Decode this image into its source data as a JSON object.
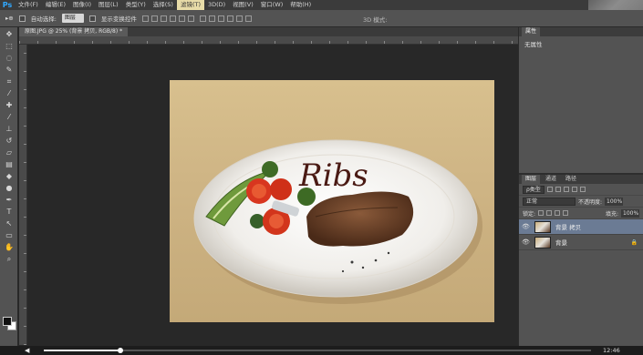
{
  "app": {
    "logo": "Ps"
  },
  "menu": [
    "文件(F)",
    "编辑(E)",
    "图像(I)",
    "图层(L)",
    "类型(Y)",
    "选择(S)",
    "滤镜(T)",
    "3D(D)",
    "视图(V)",
    "窗口(W)",
    "帮助(H)"
  ],
  "menu_active_index": 6,
  "window_controls": [
    "—",
    "□",
    "✕"
  ],
  "options": {
    "auto_select_label": "自动选择:",
    "auto_select_value": "图层",
    "show_transform_label": "显示变换控件",
    "mode_3d_label": "3D 模式:"
  },
  "document": {
    "tab_title": "原图.JPG @ 25% (背景 拷贝, RGB/8) *"
  },
  "properties": {
    "tab": "属性",
    "empty_text": "无属性"
  },
  "layers_panel": {
    "tabs": [
      "图层",
      "通道",
      "路径"
    ],
    "kind_label": "ρ类型",
    "blend_mode": "正常",
    "opacity_label": "不透明度:",
    "opacity_value": "100%",
    "lock_label": "锁定:",
    "fill_label": "填充:",
    "fill_value": "100%",
    "layers": [
      {
        "name": "背景 拷贝",
        "selected": true
      },
      {
        "name": "背景",
        "selected": false
      }
    ]
  },
  "photo": {
    "sauce_text": "Ribs"
  },
  "player": {
    "progress_fraction": 0.14,
    "time": "12:46"
  },
  "colors": {
    "accent_menu": "#e8dca8",
    "layer_selected": "#6b7b94",
    "logo": "#31a8ff"
  }
}
